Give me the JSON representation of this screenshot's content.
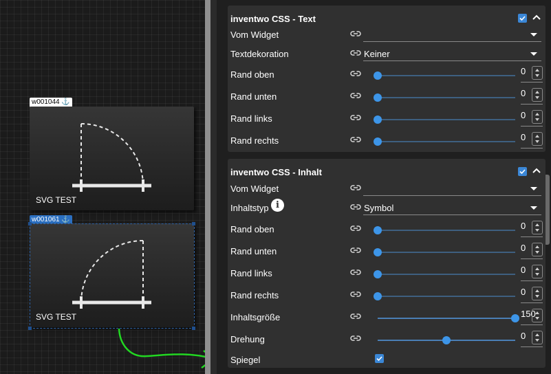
{
  "widgets": [
    {
      "id_tag": "w001044 ⚓",
      "label": "SVG TEST"
    },
    {
      "id_tag": "w001061 ⚓",
      "label": "SVG TEST"
    }
  ],
  "text_section": {
    "title": "inventwo CSS - Text",
    "enabled": true,
    "rows": [
      {
        "label": "Vom Widget",
        "type": "select",
        "value": ""
      },
      {
        "label": "Textdekoration",
        "type": "select",
        "value": "Keiner"
      },
      {
        "label": "Rand oben",
        "type": "slider",
        "value": "0",
        "fraction": 0
      },
      {
        "label": "Rand unten",
        "type": "slider",
        "value": "0",
        "fraction": 0
      },
      {
        "label": "Rand links",
        "type": "slider",
        "value": "0",
        "fraction": 0
      },
      {
        "label": "Rand rechts",
        "type": "slider",
        "value": "0",
        "fraction": 0
      }
    ]
  },
  "content_section": {
    "title": "inventwo CSS - Inhalt",
    "enabled": true,
    "info_glyph": "i",
    "rows": [
      {
        "label": "Vom Widget",
        "type": "select",
        "value": ""
      },
      {
        "label": "Inhaltstyp",
        "type": "select",
        "value": "Symbol",
        "info": true
      },
      {
        "label": "Rand oben",
        "type": "slider",
        "value": "0",
        "fraction": 0
      },
      {
        "label": "Rand unten",
        "type": "slider",
        "value": "0",
        "fraction": 0
      },
      {
        "label": "Rand links",
        "type": "slider",
        "value": "0",
        "fraction": 0
      },
      {
        "label": "Rand rechts",
        "type": "slider",
        "value": "0",
        "fraction": 0
      },
      {
        "label": "Inhaltsgröße",
        "type": "slider",
        "value": "150",
        "fraction": 1.0,
        "style": "long"
      },
      {
        "label": "Drehung",
        "type": "slider",
        "value": "0",
        "fraction": 0.5,
        "style": "long"
      },
      {
        "label": "Spiegel",
        "type": "checkbox",
        "checked": true
      }
    ]
  },
  "colors": {
    "accent": "#3d95e8",
    "panel": "#303030",
    "annotation": "#22d822"
  },
  "icons": {
    "link": "link-icon",
    "collapse": "chevron-up-icon",
    "info": "info-icon",
    "anchor": "anchor-icon"
  }
}
